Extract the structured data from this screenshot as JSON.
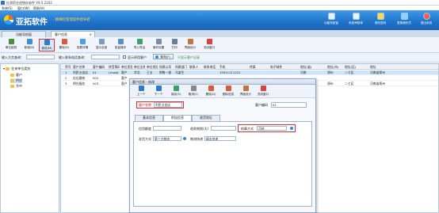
{
  "window": {
    "title": "红邦药业进销存软件 V9.5.2102"
  },
  "menu": [
    "系统(S)",
    "窗口(W)",
    "帮助(H)"
  ],
  "banner": {
    "brand": "亚拓软件",
    "slogan": "· 精细化管理软件倡导者",
    "buttons": [
      {
        "label": "功能导航窗",
        "icon": "navigator-icon"
      },
      {
        "label": "系统审核单",
        "icon": "audit-icon"
      },
      {
        "label": "修改密码",
        "icon": "password-icon"
      },
      {
        "label": "更换操作员",
        "icon": "switch-user-icon"
      },
      {
        "label": "退出系统",
        "icon": "exit-icon"
      }
    ]
  },
  "tabs": [
    {
      "label": "功能导航窗",
      "active": false
    },
    {
      "label": "客户信息",
      "active": true,
      "close": "×"
    }
  ],
  "toolbar": [
    {
      "label": "单位组别",
      "color": "#4a8e3b"
    },
    {
      "label": "新增(N)",
      "color": "#3f8ed8"
    },
    {
      "label": "修改(M)",
      "color": "#2e7bcf",
      "highlight": true
    },
    {
      "label": "删除(D)",
      "color": "#d85a3f"
    },
    {
      "label": "查看详情",
      "color": "#4e9ee5"
    },
    {
      "label": "显示全部",
      "color": "#7a9bbf"
    },
    {
      "label": "批量操作",
      "color": "#5a8fc6"
    },
    {
      "label": "导入导出",
      "color": "#3aa36a"
    },
    {
      "label": "操作设置",
      "color": "#7d8ea3"
    },
    {
      "label": "打印",
      "color": "#6b7f99"
    },
    {
      "label": "界面设计",
      "color": "#c4763a"
    },
    {
      "label": "关闭窗口",
      "color": "#d84444"
    }
  ],
  "filters": {
    "search_label": "输入方言查询：",
    "search_value": "",
    "contact_label": "输入联系电话查询：",
    "contact_value": "",
    "show_inactive_label": "显示停用客户",
    "query_button": "查询(F)",
    "hint": "只显示客户记录"
  },
  "tree": {
    "root": "往来单位类别",
    "items": [
      "客户",
      "供应",
      "华中"
    ]
  },
  "grid": {
    "headers": [
      "序号",
      "客户名称",
      "客户编码",
      "拼音简码",
      "单位类型",
      "单位全称",
      "单位地址",
      "所属公司",
      "所属部门",
      "联系人",
      "联系电话",
      "手机",
      "传真",
      "电子邮件",
      "地址(省)",
      "地址(市)",
      "地址(区)",
      "地址"
    ],
    "rows": [
      {
        "n": "1",
        "name": "利民五金店",
        "code": "01",
        "py": "Lmwjd",
        "type": "客户",
        "full": "华北",
        "addr": "王五",
        "company": "销售一部",
        "dept": "马某生",
        "contact": "",
        "phone": "",
        "mobile": "15911111222",
        "fax": "",
        "email": "",
        "prov": "河南",
        "city": "郑州",
        "dist": "二七区",
        "address": "河南省郑州",
        "selected": true
      },
      {
        "n": "2",
        "name": "佳佳建商",
        "code": "002",
        "py": "",
        "type": "客户",
        "full": "",
        "addr": "",
        "company": "",
        "dept": "",
        "contact": "",
        "phone": "",
        "mobile": "",
        "fax": "",
        "email": "",
        "prov": "",
        "city": "",
        "dist": "",
        "address": "",
        "selected": false
      },
      {
        "n": "3",
        "name": "明光服务",
        "code": "003",
        "py": "",
        "type": "客户",
        "full": "",
        "addr": "",
        "company": "",
        "dept": "",
        "contact": "",
        "phone": "",
        "mobile": "",
        "fax": "",
        "email": "",
        "prov": "河南",
        "city": "郑州",
        "dist": "二七区",
        "address": "河南省郑州",
        "selected": false
      }
    ]
  },
  "dialog": {
    "title": "客户信息 - 修改",
    "toolbar": [
      "上一个",
      "下一个",
      "保存(S)",
      "取消(C)",
      "删除(D)",
      "删除信息",
      "界面设计",
      "关闭窗口"
    ],
    "customer_name_label": "客户名称",
    "customer_name_value": "利民五金店",
    "customer_code_label": "客户编码",
    "customer_code_value": "01",
    "tabs": [
      "基本信息",
      "附加信息",
      "收货地址"
    ],
    "active_tab": 1,
    "fields": {
      "credit_label": "信用额度",
      "credit_value": "",
      "pay_term_label": "收款期限(天)",
      "pay_term_value": "",
      "settle_label": "结算方式",
      "settle_value": "月结",
      "delivery_label": "发货方式",
      "delivery_value": "第三方物流",
      "logistics_label": "物流快递",
      "logistics_value": "顺丰快递"
    }
  }
}
